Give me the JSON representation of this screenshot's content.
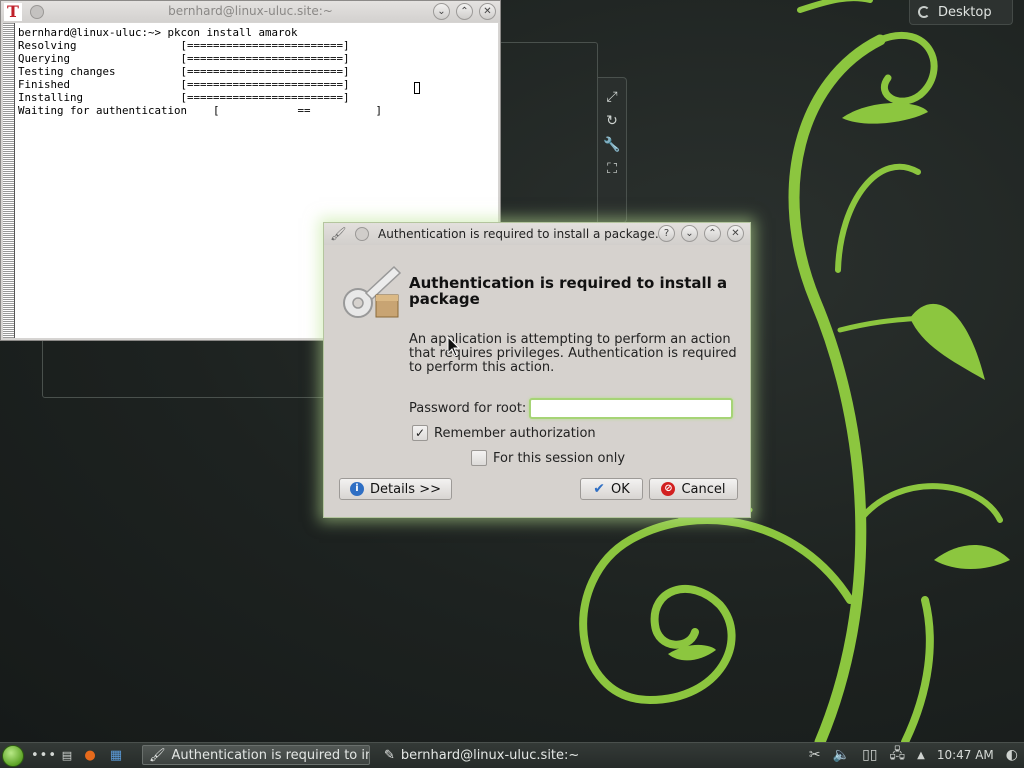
{
  "terminal": {
    "title": "bernhard@linux-uluc.site:~",
    "logo": "T",
    "lines": "bernhard@linux-uluc:~> pkcon install amarok\nResolving                [========================]\nQuerying                 [========================]\nTesting changes          [========================]\nFinished                 [========================]\nInstalling               [========================]\nWaiting for authentication    [            ==          ]"
  },
  "desktop": {
    "toolbox_label": "Desktop"
  },
  "dialog": {
    "title": "Authentication is required to install a package...",
    "heading": "Authentication is required to install a package",
    "description": "An application is attempting to perform an action that requires privileges. Authentication is required to perform this action.",
    "password_label": "Password for root:",
    "password_value": "",
    "remember_label": "Remember authorization",
    "remember_checked": true,
    "session_label": "For this session only",
    "session_checked": false,
    "details_button": "Details >>",
    "ok_button": "OK",
    "cancel_button": "Cancel"
  },
  "taskbar": {
    "task_active": "Authentication is required to in",
    "task_terminal": "bernhard@linux-uluc.site:~",
    "clock": "10:47 AM"
  },
  "colors": {
    "accent_green": "#8fc63d",
    "wallpaper": "#1e2321"
  }
}
